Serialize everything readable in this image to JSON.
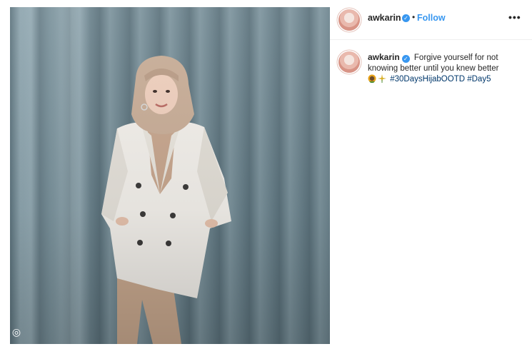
{
  "post": {
    "username": "awkarin",
    "verified_icon": "verified-badge-icon",
    "separator": "•",
    "follow_label": "Follow",
    "more_label": "•••",
    "caption_text": "Forgive yourself for not knowing better until you knew better",
    "emojis": [
      "sunflower-face-emoji",
      "sparkle-flower-emoji"
    ],
    "hashtags": [
      "#30DaysHijabOOTD",
      "#Day5"
    ]
  },
  "colors": {
    "accent": "#3897f0",
    "text": "#262626",
    "hashtag": "#00376b"
  }
}
